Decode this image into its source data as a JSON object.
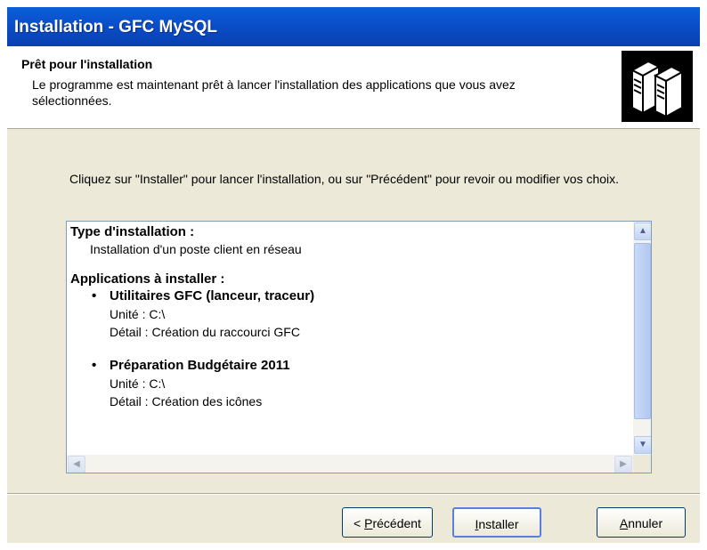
{
  "window": {
    "title": "Installation - GFC MySQL"
  },
  "header": {
    "title": "Prêt pour l'installation",
    "subtitle": "Le programme est maintenant prêt à lancer l'installation des applications que vous avez sélectionnées.",
    "icon": "server-icon"
  },
  "intro": "Cliquez sur \"Installer\" pour lancer l'installation, ou sur \"Précédent\" pour revoir ou modifier vos choix.",
  "summary": {
    "type_heading": "Type d'installation :",
    "type_value": "Installation d'un poste client en réseau",
    "apps_heading": "Applications à installer :",
    "apps": [
      {
        "name": "Utilitaires GFC (lanceur, traceur)",
        "unit": "Unité : C:\\",
        "detail": "Détail : Création du raccourci GFC"
      },
      {
        "name": "Préparation Budgétaire 2011",
        "unit": "Unité : C:\\",
        "detail": "Détail : Création des icônes"
      }
    ]
  },
  "buttons": {
    "back_prefix": "< ",
    "back_key": "P",
    "back_rest": "récédent",
    "install_key": "I",
    "install_rest": "nstaller",
    "cancel_key": "A",
    "cancel_rest": "nnuler"
  }
}
